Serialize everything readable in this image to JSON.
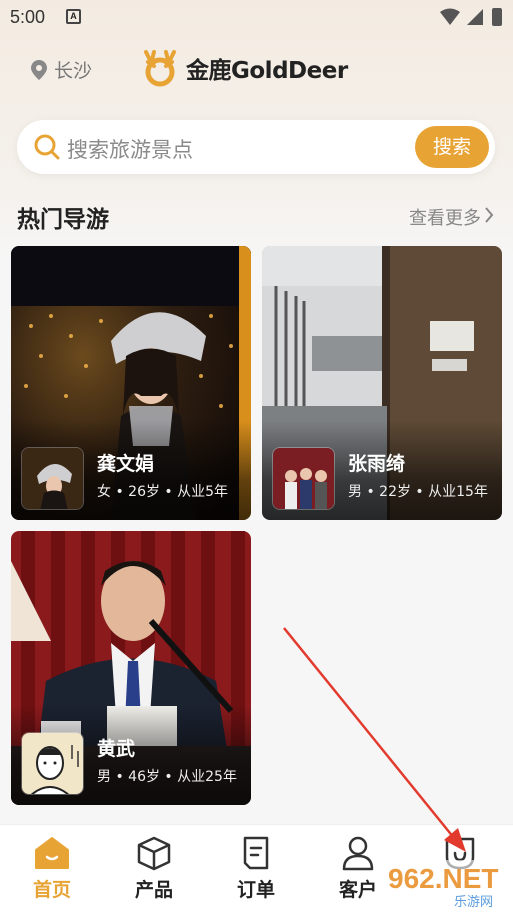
{
  "status_bar": {
    "time": "5:00"
  },
  "header": {
    "location": "长沙",
    "logo_text": "金鹿GoldDeer"
  },
  "search": {
    "placeholder": "搜索旅游景点",
    "button_label": "搜索"
  },
  "section": {
    "title": "热门导游",
    "see_more": "查看更多"
  },
  "guides": [
    {
      "name": "龚文娟",
      "meta": "女 • 26岁 • 从业5年"
    },
    {
      "name": "张雨绮",
      "meta": "男 • 22岁 • 从业15年"
    },
    {
      "name": "黄武",
      "meta": "男 • 46岁 • 从业25年"
    }
  ],
  "bottom_nav": {
    "items": [
      {
        "label": "首页",
        "icon": "home-icon"
      },
      {
        "label": "产品",
        "icon": "box-icon"
      },
      {
        "label": "订单",
        "icon": "order-icon"
      },
      {
        "label": "客户",
        "icon": "user-icon"
      },
      {
        "label": "",
        "icon": "mine-icon"
      }
    ]
  },
  "colors": {
    "accent": "#e8a335",
    "arrow": "#e23b2e"
  },
  "watermark": {
    "text": "962.NET",
    "sub": "乐游网"
  }
}
